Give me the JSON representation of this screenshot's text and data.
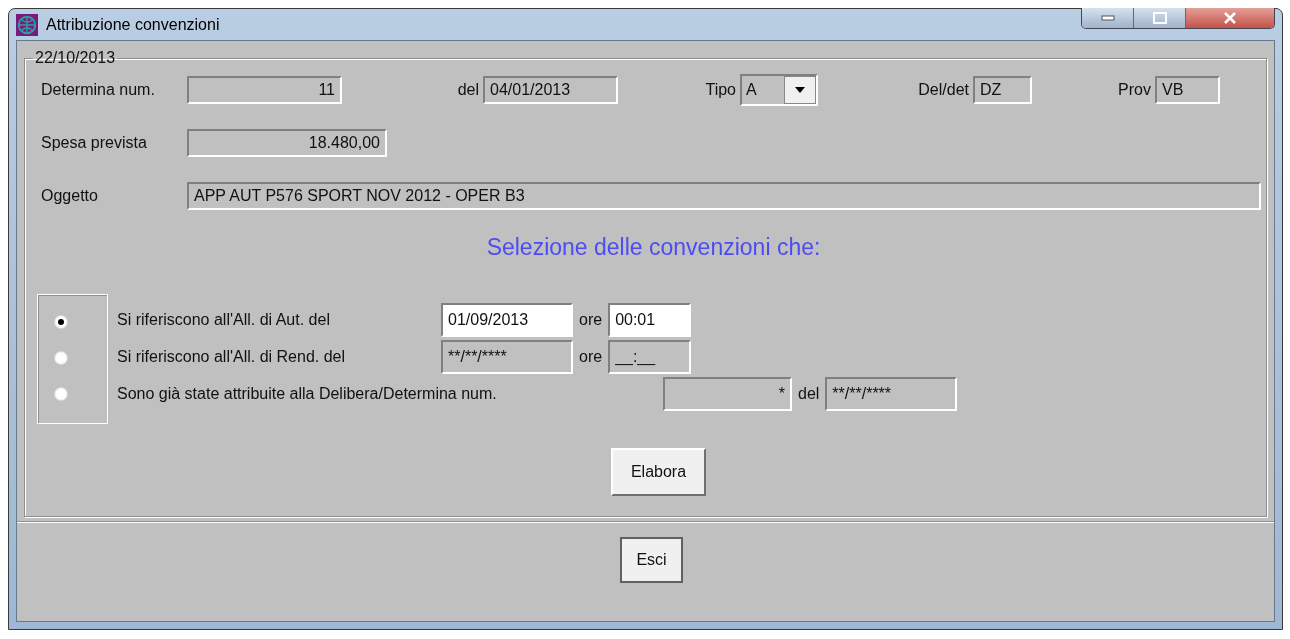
{
  "window": {
    "title": "Attribuzione convenzioni"
  },
  "group": {
    "legend": "22/10/2013"
  },
  "header_fields": [
    {
      "kind": "text",
      "label": "Determina num.",
      "value": "11"
    },
    {
      "kind": "text",
      "label": "del",
      "value": "04/01/2013"
    },
    {
      "kind": "dropdown",
      "label": "Tipo",
      "value": "A"
    },
    {
      "kind": "text",
      "label": "Del/det",
      "value": "DZ"
    },
    {
      "kind": "text",
      "label": "Prov",
      "value": "VB"
    }
  ],
  "spesa": {
    "label": "Spesa prevista",
    "value": "18.480,00"
  },
  "oggetto": {
    "label": "Oggetto",
    "value": "APP AUT P576 SPORT NOV 2012 - OPER B3"
  },
  "heading": "Selezione delle convenzioni che:",
  "options": [
    {
      "label": "Si riferiscono all'All. di Aut. del",
      "selected": true,
      "fields": [
        {
          "value": "01/09/2013",
          "disabled": false
        },
        {
          "label": "ore",
          "value": "00:01",
          "disabled": false
        }
      ]
    },
    {
      "label": "Si riferiscono all'All. di Rend. del",
      "selected": false,
      "fields": [
        {
          "value": "**/**/****",
          "disabled": true
        },
        {
          "label": "ore",
          "value": "__:__",
          "disabled": true
        }
      ]
    },
    {
      "label": "Sono già state attribuite alla Delibera/Determina num.",
      "selected": false,
      "fields": [
        {
          "value": "*",
          "disabled": true
        },
        {
          "label": "del",
          "value": "**/**/****",
          "disabled": true
        }
      ]
    }
  ],
  "elabora_button": "Elabora",
  "exit_button": "Esci"
}
